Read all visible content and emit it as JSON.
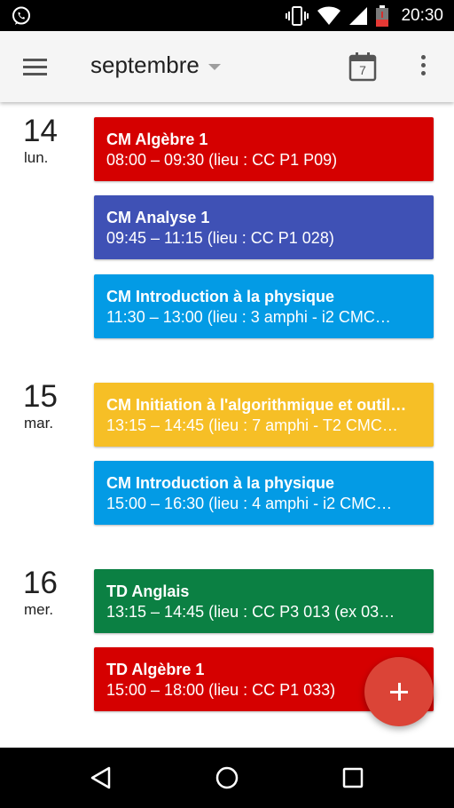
{
  "status_bar": {
    "time": "20:30",
    "icons": [
      "whatsapp-icon",
      "vibrate-icon",
      "wifi-icon",
      "signal-icon",
      "battery-low-icon"
    ]
  },
  "app_bar": {
    "month": "septembre",
    "today_date": "7",
    "icons": [
      "menu-icon",
      "dropdown-arrow-icon",
      "calendar-today-icon",
      "overflow-menu-icon"
    ]
  },
  "colors": {
    "red": "#d50000",
    "indigo": "#3f51b5",
    "light_blue": "#039be5",
    "yellow": "#f6bf26",
    "green": "#0b8043",
    "fab": "#db4437"
  },
  "days": [
    {
      "number": "14",
      "name": "lun.",
      "events": [
        {
          "title": "CM Algèbre 1",
          "detail": "08:00 – 09:30 (lieu : CC P1 P09)",
          "color": "#d50000"
        },
        {
          "title": "CM Analyse 1",
          "detail": "09:45 – 11:15 (lieu : CC P1 028)",
          "color": "#3f51b5"
        },
        {
          "title": "CM Introduction à la physique",
          "detail": "11:30 – 13:00 (lieu : 3 amphi - i2 CMC…",
          "color": "#039be5"
        }
      ]
    },
    {
      "number": "15",
      "name": "mar.",
      "events": [
        {
          "title": "CM Initiation à l'algorithmique et outil…",
          "detail": "13:15 – 14:45 (lieu : 7 amphi - T2 CMC…",
          "color": "#f6bf26"
        },
        {
          "title": "CM Introduction à la physique",
          "detail": "15:00 – 16:30 (lieu : 4 amphi - i2 CMC…",
          "color": "#039be5"
        }
      ]
    },
    {
      "number": "16",
      "name": "mer.",
      "events": [
        {
          "title": "TD Anglais",
          "detail": "13:15 – 14:45 (lieu : CC P3 013 (ex 03…",
          "color": "#0b8043"
        },
        {
          "title": "TD Algèbre 1",
          "detail": "15:00 – 18:00 (lieu : CC P1 033)",
          "color": "#d50000"
        }
      ]
    }
  ],
  "fab": {
    "icon": "add-icon"
  },
  "nav_bar": {
    "icons": [
      "back-icon",
      "home-icon",
      "recents-icon"
    ]
  }
}
